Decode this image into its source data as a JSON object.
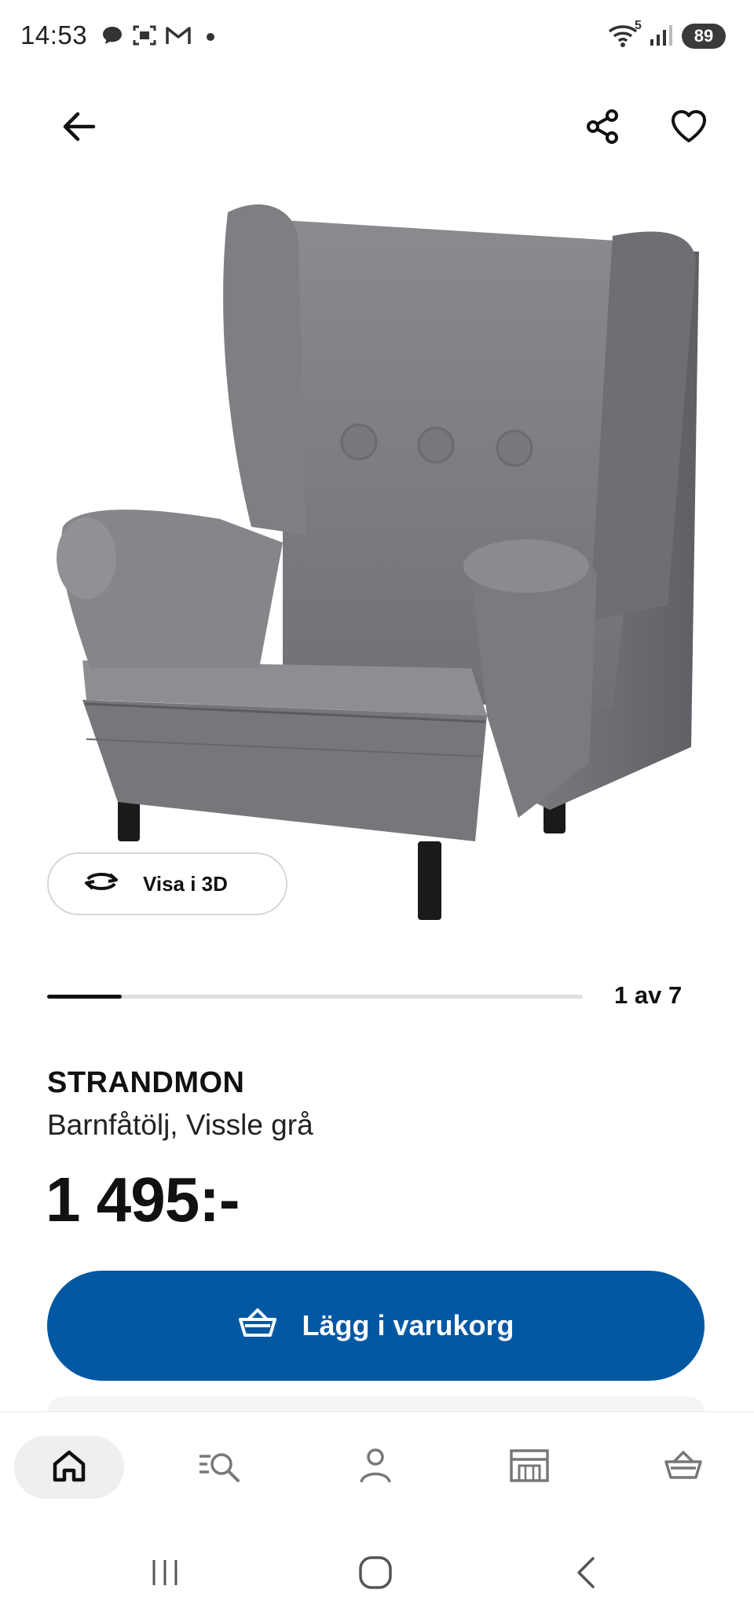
{
  "status_bar": {
    "time": "14:53",
    "notification_icons": [
      "chat-bubble-icon",
      "screenshot-icon",
      "gmail-icon",
      "dot-icon"
    ],
    "system_icons": [
      "wifi-icon",
      "signal-icon"
    ],
    "wifi_badge": "5",
    "battery": "89"
  },
  "header": {
    "back_icon": "arrow-left-icon",
    "share_icon": "share-icon",
    "favorite_icon": "heart-icon"
  },
  "gallery": {
    "view_3d_label": "Visa i 3D",
    "counter": "1 av 7",
    "position_fraction": 0.14
  },
  "product": {
    "brand": "STRANDMON",
    "description": "Barnfåtölj, Vissle grå",
    "price": "1 495:-"
  },
  "cta": {
    "add_to_cart_label": "Lägg i varukorg",
    "icon": "basket-icon",
    "color": "#0058a3"
  },
  "bottom_nav": {
    "items": [
      "home-icon",
      "search-list-icon",
      "profile-icon",
      "store-icon",
      "basket-icon"
    ],
    "active": "home"
  },
  "system_nav": {
    "buttons": [
      "recents-icon",
      "home-icon",
      "back-icon"
    ]
  }
}
